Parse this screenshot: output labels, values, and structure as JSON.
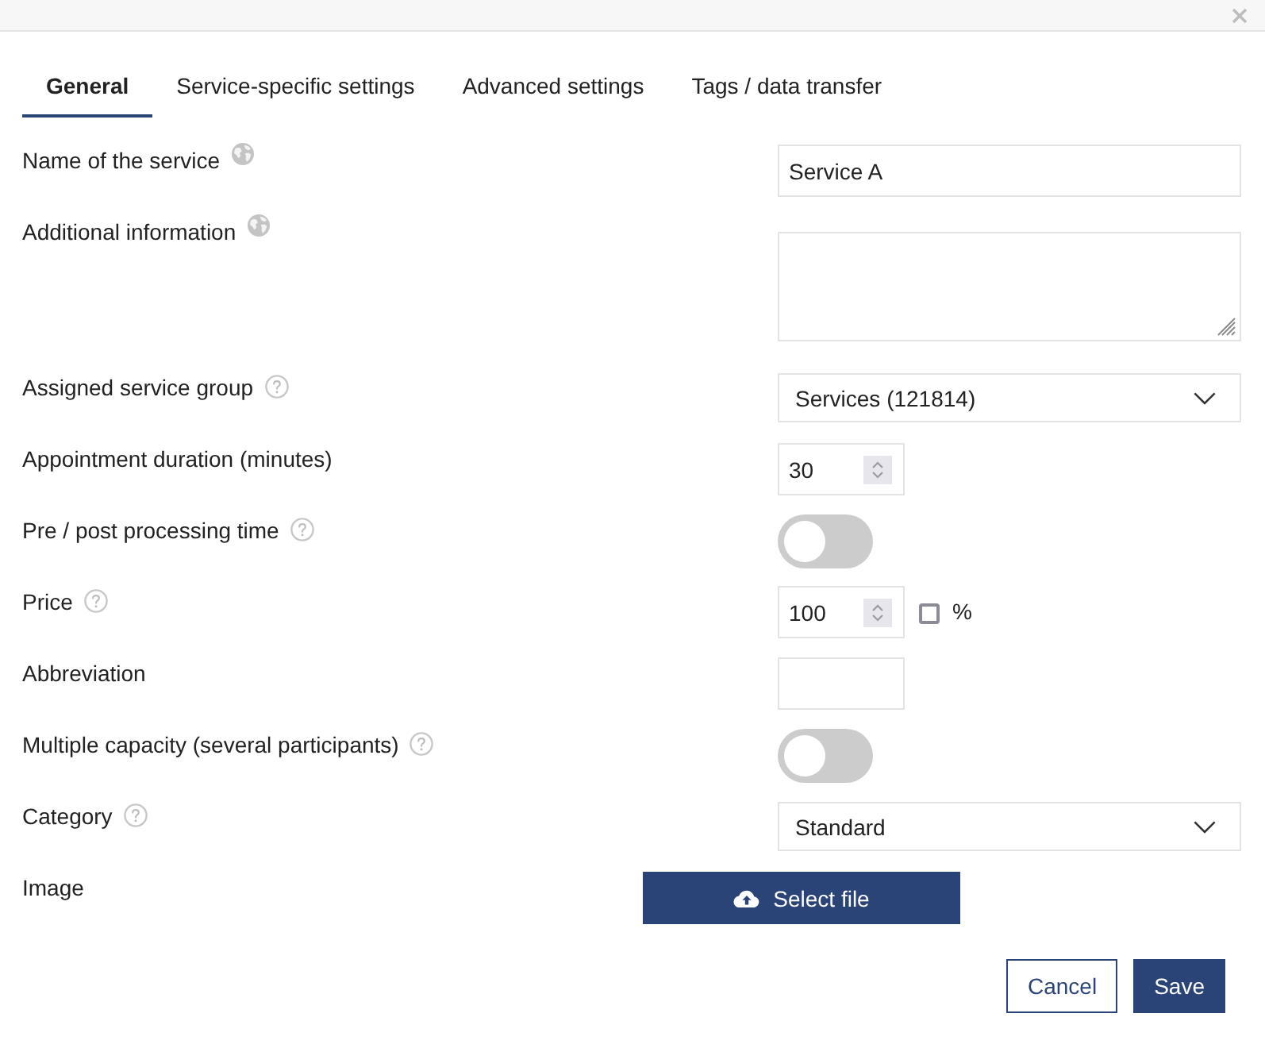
{
  "tabs": [
    {
      "label": "General",
      "selected": true
    },
    {
      "label": "Service-specific settings",
      "selected": false
    },
    {
      "label": "Advanced settings",
      "selected": false
    },
    {
      "label": "Tags / data transfer",
      "selected": false
    }
  ],
  "fields": [
    {
      "kind": "text",
      "label": "Name of the service",
      "translatable": true,
      "help": false,
      "value": "Service A"
    },
    {
      "kind": "textarea",
      "label": "Additional information",
      "translatable": true,
      "help": false
    },
    {
      "kind": "select",
      "label": "Assigned service group",
      "translatable": false,
      "help": true,
      "value": "Services (121814)"
    },
    {
      "kind": "number",
      "label": "Appointment duration (minutes)",
      "translatable": false,
      "help": false,
      "value": "30"
    },
    {
      "kind": "toggle",
      "label": "Pre / post processing time",
      "translatable": false,
      "help": true,
      "on": false
    },
    {
      "kind": "number",
      "label": "Price",
      "translatable": false,
      "help": true,
      "value": "100",
      "checkbox": {
        "label": "%",
        "checked": false
      }
    },
    {
      "kind": "short",
      "label": "Abbreviation",
      "translatable": false,
      "help": false
    },
    {
      "kind": "toggle",
      "label": "Multiple capacity (several participants)",
      "translatable": false,
      "help": true,
      "on": false
    },
    {
      "kind": "select",
      "label": "Category",
      "translatable": false,
      "help": true,
      "value": "Standard"
    },
    {
      "kind": "file",
      "label": "Image",
      "translatable": false,
      "help": false,
      "button": "Select file"
    }
  ],
  "buttons": [
    {
      "label": "Cancel",
      "kind": "secondary"
    },
    {
      "label": "Save",
      "kind": "primary"
    }
  ]
}
